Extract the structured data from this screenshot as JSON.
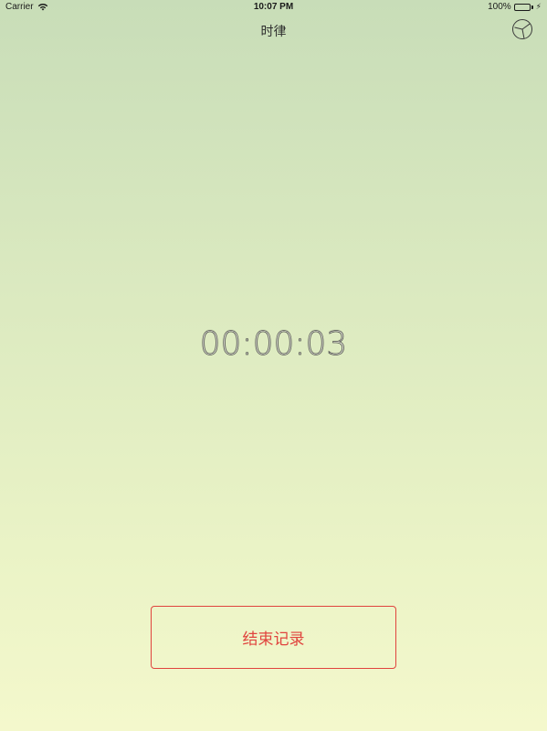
{
  "status_bar": {
    "carrier": "Carrier",
    "time": "10:07 PM",
    "battery_percent": "100%",
    "battery_level": 1.0,
    "battery_color": "#4cd964"
  },
  "nav": {
    "title": "时律",
    "stats_icon": "pie-chart-icon"
  },
  "timer": {
    "value": "00:00:03"
  },
  "actions": {
    "end_record_label": "结束记录",
    "accent_color": "#e0443e"
  }
}
